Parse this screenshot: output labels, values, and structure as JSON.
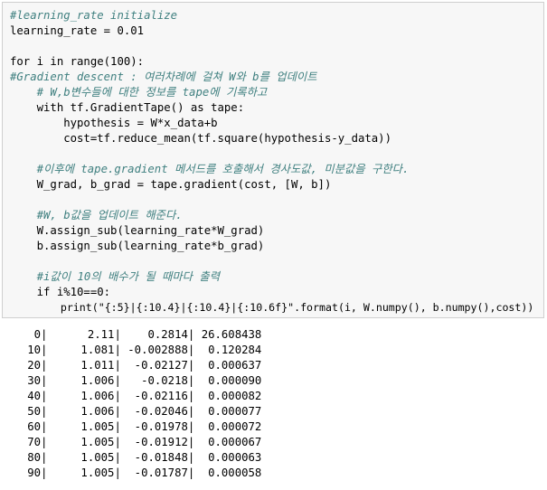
{
  "code": {
    "lines": [
      {
        "text": "#learning_rate initialize",
        "kind": "comment"
      },
      {
        "text": "learning_rate = 0.01",
        "kind": "code"
      },
      {
        "text": "",
        "kind": "blank"
      },
      {
        "text": "for i in range(100):",
        "kind": "code"
      },
      {
        "text": "#Gradient descent : 여러차례에 걸쳐 W와 b를 업데이트",
        "kind": "comment"
      },
      {
        "text": "    # W,b변수들에 대한 정보를 tape에 기록하고",
        "kind": "comment"
      },
      {
        "text": "    with tf.GradientTape() as tape:",
        "kind": "code"
      },
      {
        "text": "        hypothesis = W*x_data+b",
        "kind": "code"
      },
      {
        "text": "        cost=tf.reduce_mean(tf.square(hypothesis-y_data))",
        "kind": "code"
      },
      {
        "text": "",
        "kind": "blank"
      },
      {
        "text": "    #이후에 tape.gradient 메서드를 호출해서 경사도값, 미분값을 구한다.",
        "kind": "comment"
      },
      {
        "text": "    W_grad, b_grad = tape.gradient(cost, [W, b])",
        "kind": "code"
      },
      {
        "text": "",
        "kind": "blank"
      },
      {
        "text": "    #W, b값을 업데이트 해준다.",
        "kind": "comment"
      },
      {
        "text": "    W.assign_sub(learning_rate*W_grad)",
        "kind": "code"
      },
      {
        "text": "    b.assign_sub(learning_rate*b_grad)",
        "kind": "code"
      },
      {
        "text": "",
        "kind": "blank"
      },
      {
        "text": "    #i값이 10의 배수가 될 때마다 출력",
        "kind": "comment"
      },
      {
        "text": "    if i%10==0:",
        "kind": "code"
      },
      {
        "text": "        print(\"{:5}|{:10.4}|{:10.4}|{:10.6f}\".format(i, W.numpy(), b.numpy(),cost))",
        "kind": "code"
      }
    ]
  },
  "output": {
    "lines": [
      "    0|      2.11|    0.2814| 26.608438",
      "   10|     1.081| -0.002888|  0.120284",
      "   20|     1.011|  -0.02127|  0.000637",
      "   30|     1.006|   -0.0218|  0.000090",
      "   40|     1.006|  -0.02116|  0.000082",
      "   50|     1.006|  -0.02046|  0.000077",
      "   60|     1.005|  -0.01978|  0.000072",
      "   70|     1.005|  -0.01912|  0.000067",
      "   80|     1.005|  -0.01848|  0.000063",
      "   90|     1.005|  -0.01787|  0.000058"
    ]
  }
}
